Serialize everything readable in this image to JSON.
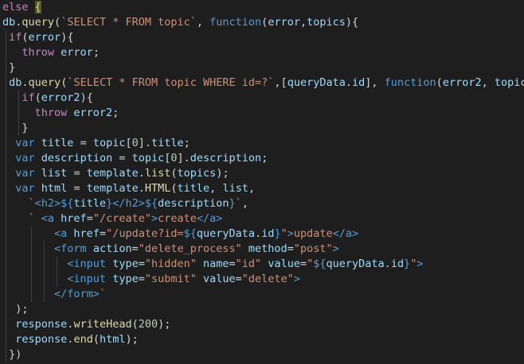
{
  "editor": {
    "language": "javascript",
    "theme": {
      "background": "#1e1e1e",
      "keyword_control": "#c586c0",
      "keyword_decl": "#569cd6",
      "function": "#dcdcaa",
      "variable": "#9cdcfe",
      "string": "#ce9178",
      "number": "#b5cea8",
      "plain": "#d4d4d4"
    },
    "lines": [
      [
        {
          "t": "else",
          "c": "kw"
        },
        {
          "t": " "
        },
        {
          "t": "{",
          "c": "cur"
        }
      ],
      [
        {
          "t": "db",
          "c": "var"
        },
        {
          "t": "."
        },
        {
          "t": "query",
          "c": "fn"
        },
        {
          "t": "("
        },
        {
          "t": "`SELECT * FROM topic`",
          "c": "str"
        },
        {
          "t": ", "
        },
        {
          "t": "function",
          "c": "decl"
        },
        {
          "t": "("
        },
        {
          "t": "error",
          "c": "var"
        },
        {
          "t": ","
        },
        {
          "t": "topics",
          "c": "var"
        },
        {
          "t": "){"
        }
      ],
      [
        {
          "t": " "
        },
        {
          "t": "if",
          "c": "kw"
        },
        {
          "t": "("
        },
        {
          "t": "error",
          "c": "var"
        },
        {
          "t": "){"
        }
      ],
      [
        {
          "t": "   "
        },
        {
          "t": "throw",
          "c": "kw"
        },
        {
          "t": " "
        },
        {
          "t": "error",
          "c": "var"
        },
        {
          "t": ";"
        }
      ],
      [
        {
          "t": " }"
        }
      ],
      [
        {
          "t": " "
        },
        {
          "t": "db",
          "c": "var"
        },
        {
          "t": "."
        },
        {
          "t": "query",
          "c": "fn"
        },
        {
          "t": "("
        },
        {
          "t": "`SELECT * FROM topic WHERE id=?`",
          "c": "str"
        },
        {
          "t": ",["
        },
        {
          "t": "queryData",
          "c": "var"
        },
        {
          "t": "."
        },
        {
          "t": "id",
          "c": "var"
        },
        {
          "t": "], "
        },
        {
          "t": "function",
          "c": "decl"
        },
        {
          "t": "("
        },
        {
          "t": "error2",
          "c": "var"
        },
        {
          "t": ", "
        },
        {
          "t": "topic",
          "c": "var"
        },
        {
          "t": "){"
        }
      ],
      [
        {
          "t": "   "
        },
        {
          "t": "if",
          "c": "kw"
        },
        {
          "t": "("
        },
        {
          "t": "error2",
          "c": "var"
        },
        {
          "t": "){"
        }
      ],
      [
        {
          "t": "     "
        },
        {
          "t": "throw",
          "c": "kw"
        },
        {
          "t": " "
        },
        {
          "t": "error2",
          "c": "var"
        },
        {
          "t": ";"
        }
      ],
      [
        {
          "t": "   }"
        }
      ],
      [
        {
          "t": "  "
        },
        {
          "t": "var",
          "c": "decl"
        },
        {
          "t": " "
        },
        {
          "t": "title",
          "c": "var"
        },
        {
          "t": " = "
        },
        {
          "t": "topic",
          "c": "var"
        },
        {
          "t": "["
        },
        {
          "t": "0",
          "c": "num"
        },
        {
          "t": "]."
        },
        {
          "t": "title",
          "c": "var"
        },
        {
          "t": ";"
        }
      ],
      [
        {
          "t": "  "
        },
        {
          "t": "var",
          "c": "decl"
        },
        {
          "t": " "
        },
        {
          "t": "description",
          "c": "var"
        },
        {
          "t": " = "
        },
        {
          "t": "topic",
          "c": "var"
        },
        {
          "t": "["
        },
        {
          "t": "0",
          "c": "num"
        },
        {
          "t": "]."
        },
        {
          "t": "description",
          "c": "var"
        },
        {
          "t": ";"
        }
      ],
      [
        {
          "t": "  "
        },
        {
          "t": "var",
          "c": "decl"
        },
        {
          "t": " "
        },
        {
          "t": "list",
          "c": "var"
        },
        {
          "t": " = "
        },
        {
          "t": "template",
          "c": "var"
        },
        {
          "t": "."
        },
        {
          "t": "list",
          "c": "fn"
        },
        {
          "t": "("
        },
        {
          "t": "topics",
          "c": "var"
        },
        {
          "t": ");"
        }
      ],
      [
        {
          "t": "  "
        },
        {
          "t": "var",
          "c": "decl"
        },
        {
          "t": " "
        },
        {
          "t": "html",
          "c": "var"
        },
        {
          "t": " = "
        },
        {
          "t": "template",
          "c": "var"
        },
        {
          "t": "."
        },
        {
          "t": "HTML",
          "c": "fn"
        },
        {
          "t": "("
        },
        {
          "t": "title",
          "c": "var"
        },
        {
          "t": ", "
        },
        {
          "t": "list",
          "c": "var"
        },
        {
          "t": ","
        }
      ],
      [
        {
          "t": "    "
        },
        {
          "t": "`",
          "c": "str"
        },
        {
          "t": "<h2>",
          "c": "tag"
        },
        {
          "t": "${",
          "c": "decl"
        },
        {
          "t": "title",
          "c": "var"
        },
        {
          "t": "}",
          "c": "decl"
        },
        {
          "t": "</h2>",
          "c": "tag"
        },
        {
          "t": "${",
          "c": "decl"
        },
        {
          "t": "description",
          "c": "var"
        },
        {
          "t": "}",
          "c": "decl"
        },
        {
          "t": "`",
          "c": "str"
        },
        {
          "t": ","
        }
      ],
      [
        {
          "t": "    "
        },
        {
          "t": "` ",
          "c": "str"
        },
        {
          "t": "<a ",
          "c": "tag"
        },
        {
          "t": "href",
          "c": "attr"
        },
        {
          "t": "="
        },
        {
          "t": "\"/create\"",
          "c": "str"
        },
        {
          "t": ">",
          "c": "tag"
        },
        {
          "t": "create",
          "c": "str"
        },
        {
          "t": "</a>",
          "c": "tag"
        }
      ],
      [
        {
          "t": "        "
        },
        {
          "t": "<a ",
          "c": "tag"
        },
        {
          "t": "href",
          "c": "attr"
        },
        {
          "t": "="
        },
        {
          "t": "\"/update?id=",
          "c": "str"
        },
        {
          "t": "${",
          "c": "decl"
        },
        {
          "t": "queryData",
          "c": "var"
        },
        {
          "t": "."
        },
        {
          "t": "id",
          "c": "var"
        },
        {
          "t": "}",
          "c": "decl"
        },
        {
          "t": "\"",
          "c": "str"
        },
        {
          "t": ">",
          "c": "tag"
        },
        {
          "t": "update",
          "c": "str"
        },
        {
          "t": "</a>",
          "c": "tag"
        }
      ],
      [
        {
          "t": "        "
        },
        {
          "t": "<form ",
          "c": "tag"
        },
        {
          "t": "action",
          "c": "attr"
        },
        {
          "t": "="
        },
        {
          "t": "\"delete_process\"",
          "c": "str"
        },
        {
          "t": " "
        },
        {
          "t": "method",
          "c": "attr"
        },
        {
          "t": "="
        },
        {
          "t": "\"post\"",
          "c": "str"
        },
        {
          "t": ">",
          "c": "tag"
        }
      ],
      [
        {
          "t": "          "
        },
        {
          "t": "<input ",
          "c": "tag"
        },
        {
          "t": "type",
          "c": "attr"
        },
        {
          "t": "="
        },
        {
          "t": "\"hidden\"",
          "c": "str"
        },
        {
          "t": " "
        },
        {
          "t": "name",
          "c": "attr"
        },
        {
          "t": "="
        },
        {
          "t": "\"id\"",
          "c": "str"
        },
        {
          "t": " "
        },
        {
          "t": "value",
          "c": "attr"
        },
        {
          "t": "="
        },
        {
          "t": "\"",
          "c": "str"
        },
        {
          "t": "${",
          "c": "decl"
        },
        {
          "t": "queryData",
          "c": "var"
        },
        {
          "t": "."
        },
        {
          "t": "id",
          "c": "var"
        },
        {
          "t": "}",
          "c": "decl"
        },
        {
          "t": "\"",
          "c": "str"
        },
        {
          "t": ">",
          "c": "tag"
        }
      ],
      [
        {
          "t": "          "
        },
        {
          "t": "<input ",
          "c": "tag"
        },
        {
          "t": "type",
          "c": "attr"
        },
        {
          "t": "="
        },
        {
          "t": "\"submit\"",
          "c": "str"
        },
        {
          "t": " "
        },
        {
          "t": "value",
          "c": "attr"
        },
        {
          "t": "="
        },
        {
          "t": "\"delete\"",
          "c": "str"
        },
        {
          "t": ">",
          "c": "tag"
        }
      ],
      [
        {
          "t": "        "
        },
        {
          "t": "</form>",
          "c": "tag"
        },
        {
          "t": "`",
          "c": "str"
        }
      ],
      [
        {
          "t": "  );"
        }
      ],
      [
        {
          "t": "  "
        },
        {
          "t": "response",
          "c": "var"
        },
        {
          "t": "."
        },
        {
          "t": "writeHead",
          "c": "fn"
        },
        {
          "t": "("
        },
        {
          "t": "200",
          "c": "num"
        },
        {
          "t": ");"
        }
      ],
      [
        {
          "t": "  "
        },
        {
          "t": "response",
          "c": "var"
        },
        {
          "t": "."
        },
        {
          "t": "end",
          "c": "fn"
        },
        {
          "t": "("
        },
        {
          "t": "html",
          "c": "var"
        },
        {
          "t": ");"
        }
      ],
      [
        {
          "t": " })"
        }
      ]
    ]
  }
}
